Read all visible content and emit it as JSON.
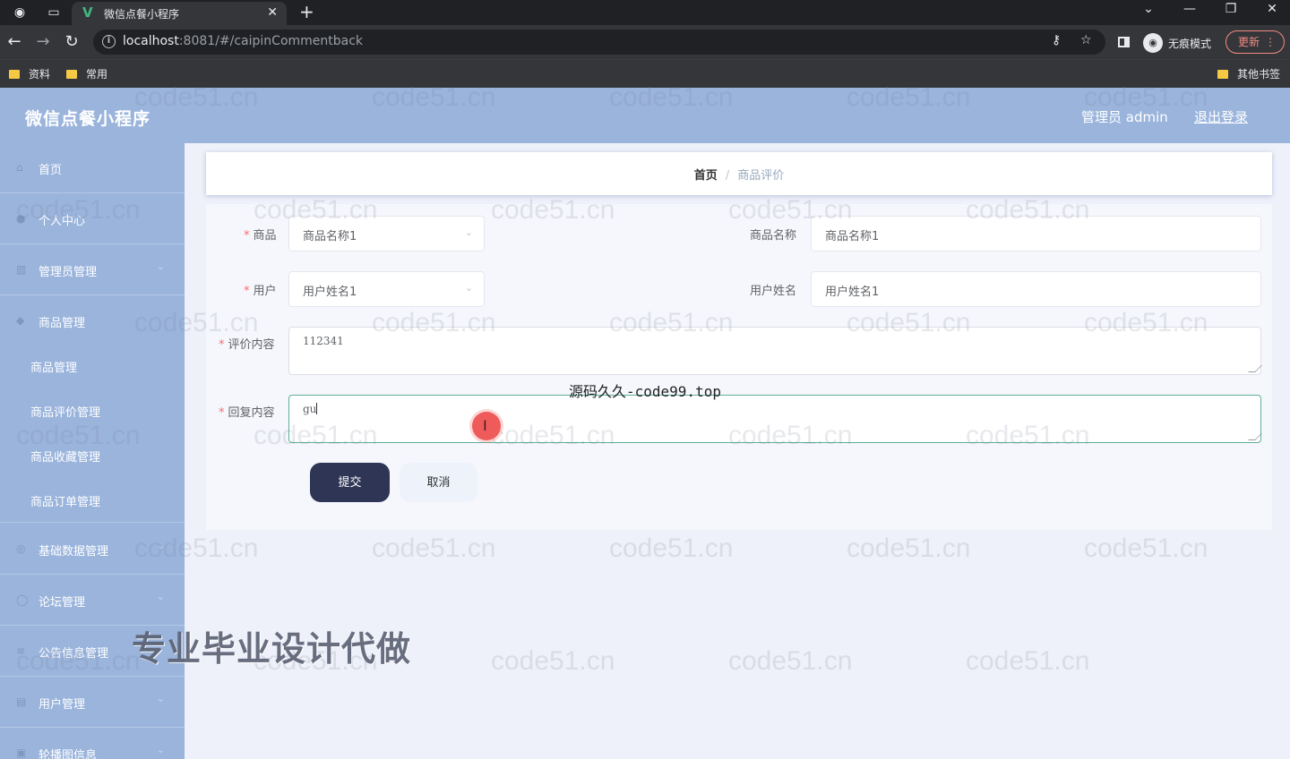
{
  "browser": {
    "tab_title": "微信点餐小程序",
    "url_host": "localhost",
    "url_rest": ":8081/#/caipinCommentback",
    "incognito_label": "无痕模式",
    "update_label": "更新",
    "bookmarks": [
      "资料",
      "常用"
    ],
    "other_bookmarks": "其他书签"
  },
  "header": {
    "logo": "微信点餐小程序",
    "admin_label": "管理员 admin",
    "logout": "退出登录"
  },
  "sidebar": {
    "items": [
      {
        "label": "首页"
      },
      {
        "label": "个人中心"
      },
      {
        "label": "管理员管理"
      },
      {
        "label": "商品管理"
      },
      {
        "label": "商品管理"
      },
      {
        "label": "商品评价管理"
      },
      {
        "label": "商品收藏管理"
      },
      {
        "label": "商品订单管理"
      },
      {
        "label": "基础数据管理"
      },
      {
        "label": "论坛管理"
      },
      {
        "label": "公告信息管理"
      },
      {
        "label": "用户管理"
      },
      {
        "label": "轮播图信息"
      }
    ]
  },
  "breadcrumb": {
    "home": "首页",
    "separator": "/",
    "current": "商品评价"
  },
  "form": {
    "product_label": "商品",
    "product_value": "商品名称1",
    "product_name_label": "商品名称",
    "product_name_value": "商品名称1",
    "user_label": "用户",
    "user_value": "用户姓名1",
    "user_name_label": "用户姓名",
    "user_name_value": "用户姓名1",
    "review_label": "评价内容",
    "review_value": "112341",
    "reply_label": "回复内容",
    "reply_value": "gu",
    "submit": "提交",
    "cancel": "取消"
  },
  "overlay": {
    "top_text": "源码久久-code99.top",
    "ad_text": "专业毕业设计代做",
    "watermark": "code51.cn"
  },
  "colors": {
    "header_bg": "#9ab4dc",
    "submit_bg": "#2f3555",
    "required": "#f56c6c",
    "focus_border": "#5daf97"
  }
}
